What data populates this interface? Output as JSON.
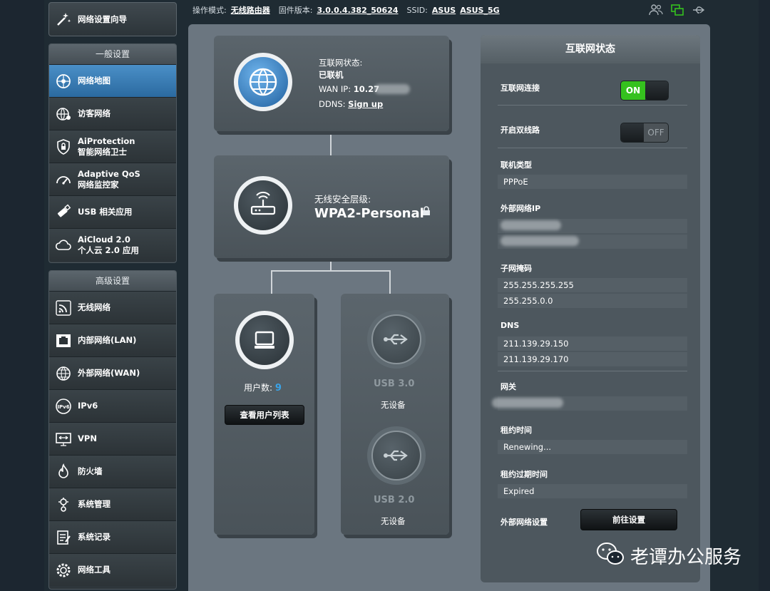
{
  "header": {
    "mode_label": "操作模式:",
    "mode_value": "无线路由器",
    "firmware_label": "固件版本:",
    "firmware_value": "3.0.0.4.382_50624",
    "ssid_label": "SSID:",
    "ssid_1": "ASUS",
    "ssid_2": "ASUS_5G"
  },
  "sidebar": {
    "wizard": "网络设置向导",
    "general_title": "一般设置",
    "general_items": [
      {
        "line1": "网络地图",
        "line2": ""
      },
      {
        "line1": "访客网络",
        "line2": ""
      },
      {
        "line1": "AiProtection",
        "line2": "智能网络卫士"
      },
      {
        "line1": "Adaptive QoS",
        "line2": "网络监控家"
      },
      {
        "line1": "USB 相关应用",
        "line2": ""
      },
      {
        "line1": "AiCloud 2.0",
        "line2": "个人云 2.0 应用"
      }
    ],
    "advanced_title": "高级设置",
    "advanced_items": [
      "无线网络",
      "内部网络(LAN)",
      "外部网络(WAN)",
      "IPv6",
      "VPN",
      "防火墙",
      "系统管理",
      "系统记录",
      "网络工具"
    ]
  },
  "map": {
    "internet_status_label": "互联网状态:",
    "internet_status_value": "已联机",
    "wan_ip_label": "WAN IP:",
    "wan_ip_value": "10.27",
    "ddns_label": "DDNS:",
    "ddns_link": "Sign up",
    "security_label": "无线安全层级:",
    "security_value": "WPA2-Personal",
    "clients_label": "用户数:",
    "clients_count": "9",
    "client_list_button": "查看用户列表",
    "usb3_label": "USB 3.0",
    "usb3_status": "无设备",
    "usb2_label": "USB 2.0",
    "usb2_status": "无设备"
  },
  "status_panel": {
    "title": "互联网状态",
    "internet_connection": "互联网连接",
    "toggle_on": "ON",
    "dual_wan": "开启双线路",
    "toggle_off": "OFF",
    "conn_type_label": "联机类型",
    "conn_type_value": "PPPoE",
    "wan_ip_label": "外部网络IP",
    "subnet_label": "子网掩码",
    "subnet_1": "255.255.255.255",
    "subnet_2": "255.255.0.0",
    "dns_label": "DNS",
    "dns_1": "211.139.29.150",
    "dns_2": "211.139.29.170",
    "gateway_label": "网关",
    "lease_label": "租约时间",
    "lease_value": "Renewing...",
    "lease_expire_label": "租约过期时间",
    "lease_expire_value": "Expired",
    "wan_settings_label": "外部网络设置",
    "goto_button": "前往设置"
  },
  "watermark": "老谭办公服务",
  "colors": {
    "accent_blue": "#2b6aa0",
    "toggle_green": "#35c11e",
    "client_count_blue": "#3aa3e8"
  }
}
